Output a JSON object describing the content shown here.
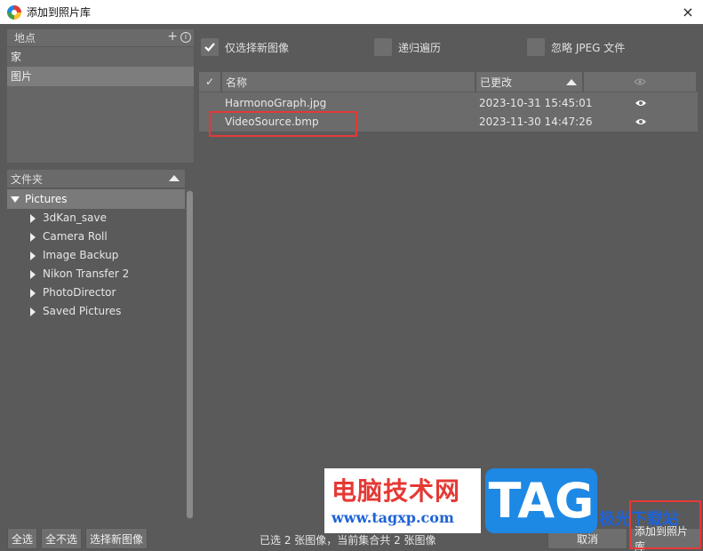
{
  "window": {
    "title": "添加到照片库",
    "close_icon": "×"
  },
  "locations": {
    "header": "地点",
    "add_icon": "+",
    "info_icon": "i",
    "items": [
      "家",
      "图片"
    ]
  },
  "folders": {
    "header": "文件夹",
    "root": "Pictures",
    "children": [
      "3dKan_save",
      "Camera Roll",
      "Image Backup",
      "Nikon Transfer 2",
      "PhotoDirector",
      "Saved Pictures"
    ]
  },
  "options": {
    "only_new": "仅选择新图像",
    "recursive": "递归遍历",
    "ignore_jpeg": "忽略 JPEG 文件"
  },
  "table": {
    "check_header": "✓",
    "col_name": "名称",
    "col_modified": "已更改",
    "rows": [
      {
        "name": "HarmonoGraph.jpg",
        "date": "2023-10-31 15:45:01"
      },
      {
        "name": "VideoSource.bmp",
        "date": "2023-11-30 14:47:26"
      }
    ]
  },
  "footer": {
    "select_all": "全选",
    "select_none": "全不选",
    "select_new": "选择新图像",
    "status": "已选 2 张图像，当前集合共 2 张图像",
    "cancel": "取消",
    "add": "添加到照片库"
  },
  "watermark": {
    "cn": "电脑技术网",
    "url": "www.tagxp.com",
    "tag": "TAG",
    "site": "极光下载站"
  },
  "colors": {
    "annotation": "#e53935",
    "background": "#5a5a5a"
  }
}
